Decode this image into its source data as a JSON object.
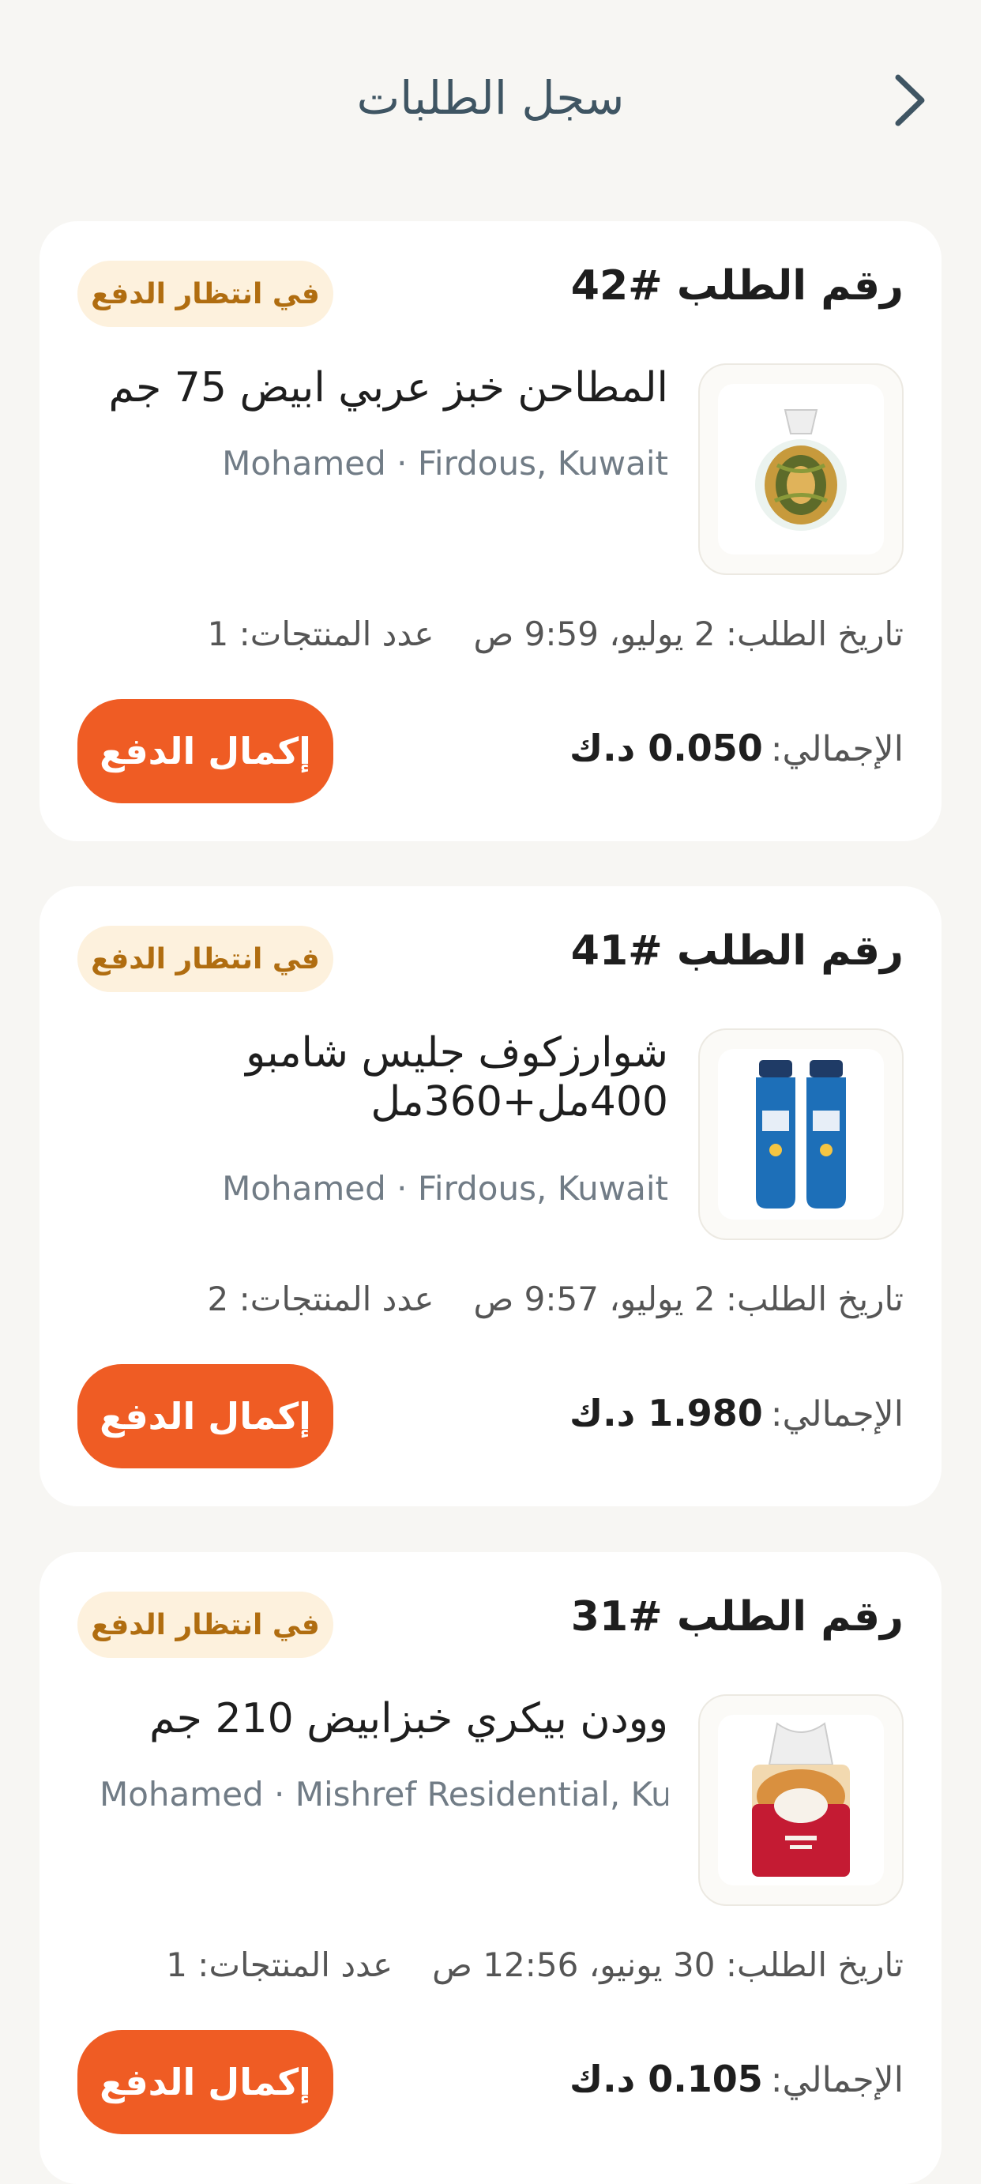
{
  "header": {
    "title": "سجل الطلبات"
  },
  "orders": [
    {
      "order_no": "رقم الطلب #42",
      "status": "في انتظار الدفع",
      "product": "المطاحن خبز عربي ابيض 75 جم",
      "meta": "Mohamed · Firdous, Kuwait",
      "date": "تاريخ الطلب: 2 يوليو، 9:59 ص",
      "count": "عدد المنتجات: 1",
      "total_label": "الإجمالي:",
      "total_value": "0.050 د.ك",
      "button": "إكمال الدفع",
      "image": "bread-bag-image"
    },
    {
      "order_no": "رقم الطلب #41",
      "status": "في انتظار الدفع",
      "product": "شوارزكوف جليس شامبو 400مل+360مل",
      "meta": "Mohamed · Firdous, Kuwait",
      "date": "تاريخ الطلب: 2 يوليو، 9:57 ص",
      "count": "عدد المنتجات: 2",
      "total_label": "الإجمالي:",
      "total_value": "1.980 د.ك",
      "button": "إكمال الدفع",
      "image": "shampoo-bottles-image"
    },
    {
      "order_no": "رقم الطلب #31",
      "status": "في انتظار الدفع",
      "product": "وودن بيكري خبزابيض 210 جم",
      "meta": "Mohamed · Mishref Residential, Ku...",
      "date": "تاريخ الطلب: 30 يونيو، 12:56 ص",
      "count": "عدد المنتجات: 1",
      "total_label": "الإجمالي:",
      "total_value": "0.105 د.ك",
      "button": "إكمال الدفع",
      "image": "wooden-bakery-bread-image"
    }
  ],
  "colors": {
    "background": "#f7f6f3",
    "card": "#ffffff",
    "status_bg": "#fdf1dd",
    "status_text": "#b06d10",
    "accent": "#ef5c24",
    "title": "#3f5563"
  }
}
